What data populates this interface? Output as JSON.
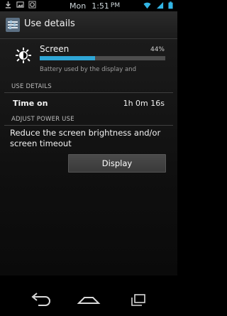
{
  "status_bar": {
    "day": "Mon",
    "time": "1:51",
    "ampm": "PM",
    "icons": [
      "download-icon",
      "gallery-icon",
      "sync-icon",
      "wifi-icon",
      "signal-icon",
      "battery-icon"
    ]
  },
  "action_bar": {
    "title": "Use details",
    "icon": "settings-app-icon"
  },
  "app": {
    "name": "Screen",
    "percent": "44%",
    "percent_value": 44,
    "subtitle": "Battery used by the display and",
    "icon": "brightness-icon",
    "bar_color": "#2fa6d6"
  },
  "use_details": {
    "header": "USE DETAILS",
    "rows": [
      {
        "label": "Time on",
        "value": "1h 0m 16s"
      }
    ]
  },
  "adjust_power": {
    "header": "ADJUST POWER USE",
    "suggestion": "Reduce the screen brightness and/or screen timeout",
    "button_label": "Display"
  },
  "nav": {
    "icons": [
      "back-icon",
      "home-icon",
      "recents-icon"
    ]
  }
}
